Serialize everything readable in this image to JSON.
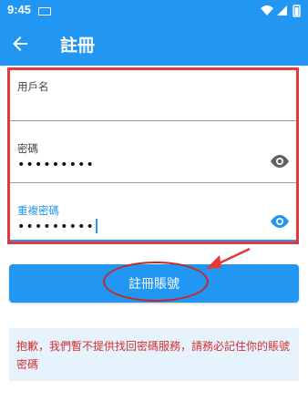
{
  "status_bar": {
    "time": "9:45"
  },
  "app_bar": {
    "title": "註冊"
  },
  "form": {
    "username": {
      "label": "用戶名",
      "value": ""
    },
    "password": {
      "label": "密碼",
      "value": "•••••••••"
    },
    "confirm_password": {
      "label": "重複密碼",
      "value": "•••••••••"
    }
  },
  "register_button": {
    "label": "註冊賬號"
  },
  "notice": {
    "text": "抱歉，我們暫不提供找回密碼服務，請務必記住你的賬號密碼"
  },
  "colors": {
    "primary": "#2196f3",
    "annotation_red": "#e53935",
    "notice_text": "#d32f2f",
    "notice_bg": "#e6f3fd"
  }
}
